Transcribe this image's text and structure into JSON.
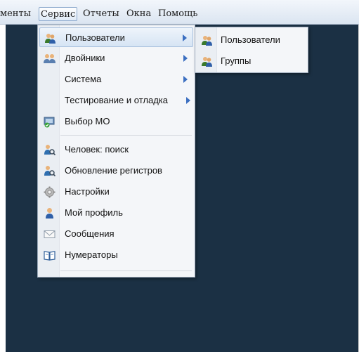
{
  "menubar": {
    "items": [
      {
        "label": "менты"
      },
      {
        "label": "Сервис"
      },
      {
        "label": "Отчеты"
      },
      {
        "label": "Окна"
      },
      {
        "label": "Помощь"
      }
    ]
  },
  "service_menu": {
    "items": [
      {
        "label": "Пользователи",
        "icon": "users-icon"
      },
      {
        "label": "Двойники",
        "icon": "doubles-icon"
      },
      {
        "label": "Система"
      },
      {
        "label": "Тестирование и отладка"
      },
      {
        "label": "Выбор МО",
        "icon": "mo-select-icon"
      },
      {
        "label": "Человек: поиск",
        "icon": "person-search-icon"
      },
      {
        "label": "Обновление регистров",
        "icon": "registry-update-icon"
      },
      {
        "label": "Настройки",
        "icon": "gear-icon"
      },
      {
        "label": "Мой профиль",
        "icon": "profile-icon"
      },
      {
        "label": "Сообщения",
        "icon": "envelope-icon"
      },
      {
        "label": "Нумераторы",
        "icon": "book-icon"
      }
    ]
  },
  "users_submenu": {
    "items": [
      {
        "label": "Пользователи",
        "icon": "users-icon"
      },
      {
        "label": "Группы",
        "icon": "groups-icon"
      }
    ]
  },
  "colors": {
    "workspace": "#1b3044",
    "accent": "#3b6fc1"
  }
}
